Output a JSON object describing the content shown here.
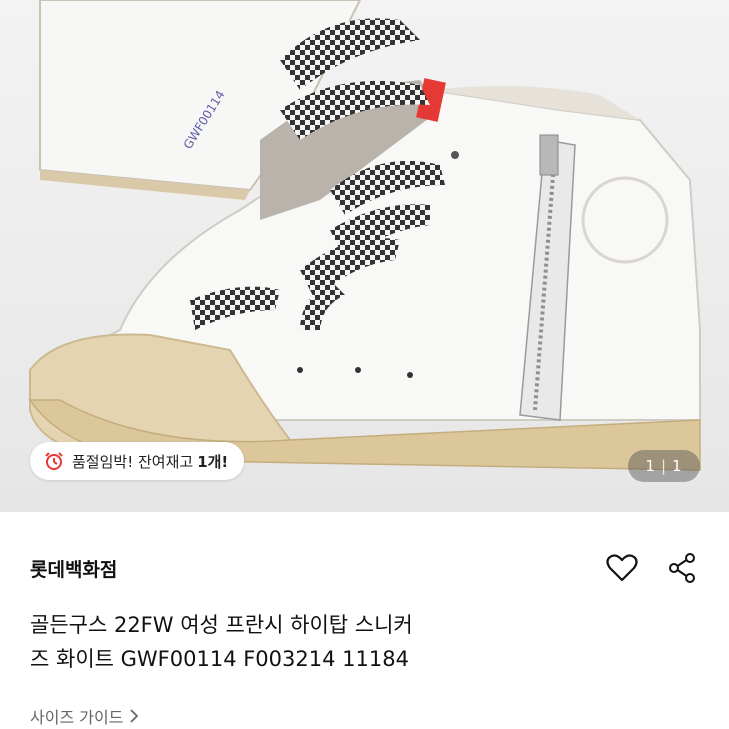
{
  "product_image": {
    "description_icon": "sneaker-photo",
    "stock_badge": {
      "text": "품절임박! 잔여재고 ",
      "count": "1개!",
      "icon": "alarm-clock-icon"
    },
    "counter": {
      "current": "1",
      "total": "1"
    }
  },
  "product": {
    "brand": "롯데백화점",
    "title_line1": "골든구스 22FW 여성 프란시 하이탑 스니커",
    "title_line2": "즈 화이트 GWF00114 F003214 11184",
    "size_guide": "사이즈 가이드"
  },
  "colors": {
    "accent_red": "#e53935",
    "text_primary": "#111111",
    "text_secondary": "#666666"
  }
}
